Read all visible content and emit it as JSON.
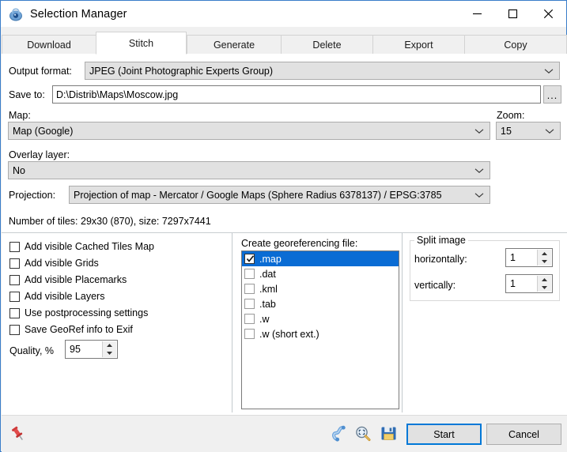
{
  "window": {
    "title": "Selection Manager",
    "icon": "app-globe-icon",
    "minimize_label": "Minimize",
    "maximize_label": "Maximize",
    "close_label": "Close"
  },
  "tabs": [
    {
      "label": "Download",
      "active": false
    },
    {
      "label": "Stitch",
      "active": true
    },
    {
      "label": "Generate",
      "active": false
    },
    {
      "label": "Delete",
      "active": false
    },
    {
      "label": "Export",
      "active": false
    },
    {
      "label": "Copy",
      "active": false
    }
  ],
  "form": {
    "output_format_label": "Output format:",
    "output_format_value": "JPEG (Joint Photographic Experts Group)",
    "save_to_label": "Save to:",
    "save_to_value": "D:\\Distrib\\Maps\\Moscow.jpg",
    "browse_label": "...",
    "map_label": "Map:",
    "map_value": "Map (Google)",
    "zoom_label": "Zoom:",
    "zoom_value": "15",
    "overlay_label": "Overlay layer:",
    "overlay_value": "No",
    "projection_label": "Projection:",
    "projection_value": "Projection of map - Mercator / Google Maps (Sphere Radius 6378137) / EPSG:3785",
    "tiles_info": "Number of tiles: 29x30 (870), size: 7297x7441"
  },
  "options": {
    "checkboxes": [
      {
        "label": "Add visible Cached Tiles Map",
        "checked": false
      },
      {
        "label": "Add visible Grids",
        "checked": false
      },
      {
        "label": "Add visible Placemarks",
        "checked": false
      },
      {
        "label": "Add visible Layers",
        "checked": false
      },
      {
        "label": "Use postprocessing settings",
        "checked": false
      },
      {
        "label": "Save GeoRef info to Exif",
        "checked": false
      }
    ],
    "quality_label": "Quality, %",
    "quality_value": "95"
  },
  "georef": {
    "title": "Create georeferencing file:",
    "items": [
      {
        "label": ".map",
        "checked": true,
        "selected": true
      },
      {
        "label": ".dat",
        "checked": false,
        "selected": false
      },
      {
        "label": ".kml",
        "checked": false,
        "selected": false
      },
      {
        "label": ".tab",
        "checked": false,
        "selected": false
      },
      {
        "label": ".w",
        "checked": false,
        "selected": false
      },
      {
        "label": ".w (short ext.)",
        "checked": false,
        "selected": false
      }
    ]
  },
  "split": {
    "title": "Split image",
    "horizontal_label": "horizontally:",
    "horizontal_value": "1",
    "vertical_label": "vertically:",
    "vertical_value": "1"
  },
  "footer": {
    "pin_icon": "pushpin-icon",
    "route_icon": "polyline-route-icon",
    "zoom_icon": "zoom-to-selection-icon",
    "save_icon": "floppy-save-icon",
    "start_label": "Start",
    "cancel_label": "Cancel"
  },
  "colors": {
    "accent": "#0078d7",
    "selection": "#0a6cd4",
    "window_border": "#3a7dc9",
    "control_face": "#e1e1e1",
    "dialog_face": "#f0f0f0"
  }
}
